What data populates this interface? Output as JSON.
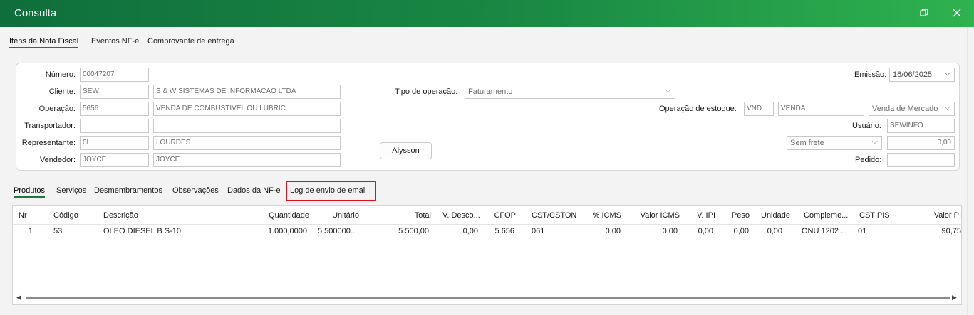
{
  "window": {
    "title": "Consulta",
    "restore_icon": "restore-icon",
    "close_icon": "close-icon"
  },
  "top_tabs": [
    {
      "label": "Itens da Nota Fiscal",
      "active": true
    },
    {
      "label": "Eventos NF-e",
      "active": false
    },
    {
      "label": "Comprovante de entrega",
      "active": false
    }
  ],
  "form": {
    "numero": {
      "label": "Número:",
      "value": "00047207"
    },
    "cliente": {
      "label": "Cliente:",
      "code": "SEW",
      "name": "S & W SISTEMAS DE INFORMACAO LTDA"
    },
    "operacao": {
      "label": "Operação:",
      "code": "5656",
      "name": "VENDA DE COMBUSTIVEL OU LUBRIC"
    },
    "transportador": {
      "label": "Transportador:",
      "code": "",
      "name": ""
    },
    "representante": {
      "label": "Representante:",
      "code": "0L",
      "name": "LOURDES"
    },
    "vendedor": {
      "label": "Vendedor:",
      "code": "JOYCE",
      "name": "JOYCE"
    },
    "tipo_operacao": {
      "label": "Tipo de operação:",
      "value": "Faturamento"
    },
    "user_button": "Alysson",
    "emissao": {
      "label": "Emissão:",
      "value": "16/06/2025"
    },
    "operacao_estoque": {
      "label": "Operação de estoque:",
      "code": "VND",
      "name": "VENDA",
      "type": "Venda de Mercado"
    },
    "usuario": {
      "label": "Usuário:",
      "value": "SEWINFO"
    },
    "frete": {
      "value": "Sem frete",
      "amount": "0,00"
    },
    "pedido": {
      "label": "Pedido:",
      "value": ""
    }
  },
  "sub_tabs": [
    {
      "label": "Produtos",
      "active": true
    },
    {
      "label": "Serviços",
      "active": false
    },
    {
      "label": "Desmembramentos",
      "active": false
    },
    {
      "label": "Observações",
      "active": false
    },
    {
      "label": "Dados da NF-e",
      "active": false
    },
    {
      "label": "Log de envio de email",
      "active": false,
      "highlighted": true
    }
  ],
  "grid": {
    "columns": [
      "Nr",
      "Código",
      "Descrição",
      "Quantidade",
      "Unitário",
      "Total",
      "V. Desco...",
      "CFOP",
      "CST/CSTON",
      "% ICMS",
      "Valor ICMS",
      "V. IPI",
      "Peso",
      "Unidade",
      "Compleme...",
      "CST PIS",
      "Valor PI"
    ],
    "rows": [
      [
        "1",
        "53",
        "OLEO DIESEL B S-10",
        "1.000,0000",
        "5,500000...",
        "5.500,00",
        "0,00",
        "5.656",
        "061",
        "0,00",
        "0,00",
        "0,00",
        "0,00",
        "0,00",
        "ONU 1202 ...",
        "01",
        "90,75"
      ]
    ]
  },
  "colors": {
    "title_start": "#0f6e3c",
    "title_end": "#2fb24f",
    "accent": "#1a7a3f",
    "highlight": "#e0101a"
  }
}
